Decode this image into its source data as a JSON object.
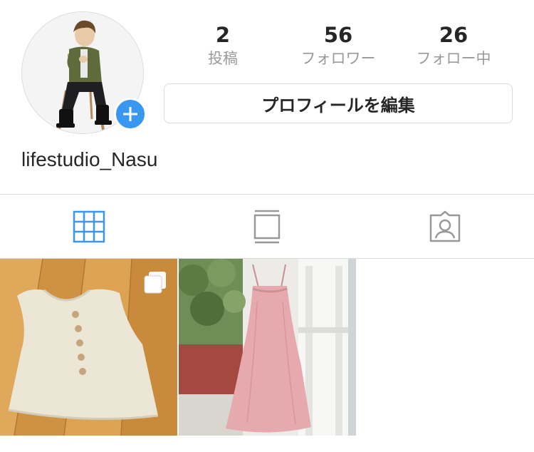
{
  "profile": {
    "username": "lifestudio_Nasu",
    "avatar_icon": "profile-photo",
    "add_icon": "plus-icon",
    "accent_color": "#3897f0"
  },
  "stats": {
    "posts": {
      "value": "2",
      "label": "投稿"
    },
    "followers": {
      "value": "56",
      "label": "フォロワー"
    },
    "following": {
      "value": "26",
      "label": "フォロー中"
    }
  },
  "actions": {
    "edit_profile_label": "プロフィールを編集"
  },
  "tabs": [
    {
      "icon": "grid-icon",
      "active": true,
      "color": "#3897f0"
    },
    {
      "icon": "feed-icon",
      "active": false,
      "color": "#999999"
    },
    {
      "icon": "tagged-icon",
      "active": false,
      "color": "#999999"
    }
  ],
  "posts": [
    {
      "description": "beige linen sleeveless top on wooden floor",
      "multiple": true
    },
    {
      "description": "pink camisole dress hanging on white chair",
      "multiple": false
    }
  ]
}
